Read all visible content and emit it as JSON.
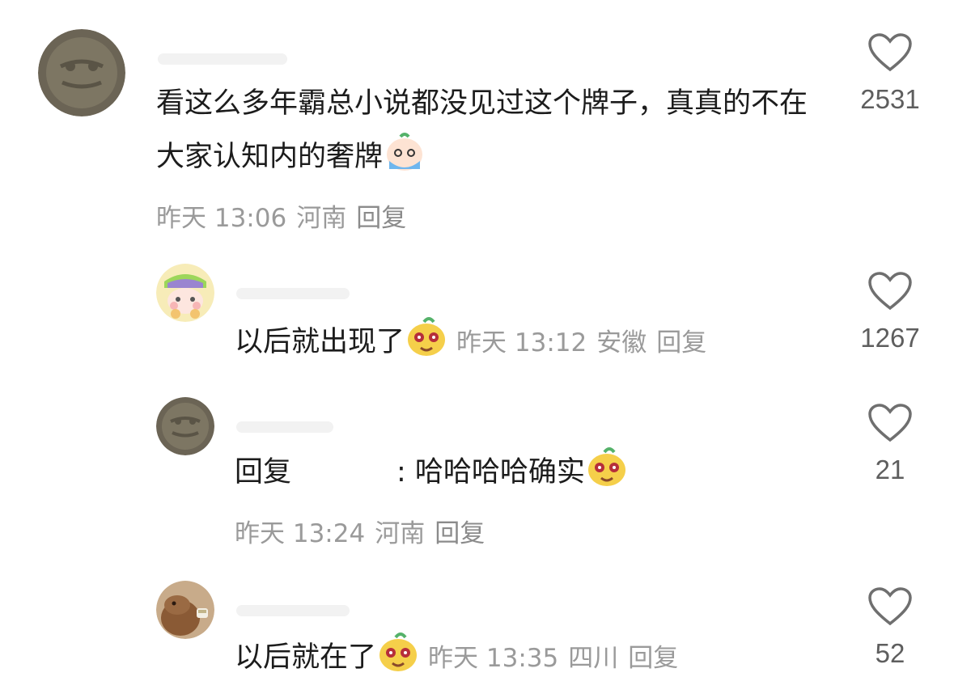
{
  "comments": [
    {
      "text": "看这么多年霸总小说都没见过这个牌子，真真的不在大家认知内的奢牌",
      "time": "昨天 13:06",
      "location": "河南",
      "reply_label": "回复",
      "likes": "2531"
    },
    {
      "text": "以后就出现了",
      "time": "昨天 13:12",
      "location": "安徽",
      "reply_label": "回复",
      "likes": "1267"
    },
    {
      "reply_prefix": "回复",
      "text": ": 哈哈哈哈确实",
      "time": "昨天 13:24",
      "location": "河南",
      "reply_label": "回复",
      "likes": "21"
    },
    {
      "text": "以后就在了",
      "time": "昨天 13:35",
      "location": "四川",
      "reply_label": "回复",
      "likes": "52"
    }
  ],
  "colors": {
    "text": "#1c1c1c",
    "meta": "#9a9a9a",
    "like_count": "#5e5e5e"
  },
  "icons": {
    "like": "heart-outline-icon",
    "emoji_crying": "crying-emoji-icon",
    "emoji_smug": "smug-emoji-icon"
  }
}
